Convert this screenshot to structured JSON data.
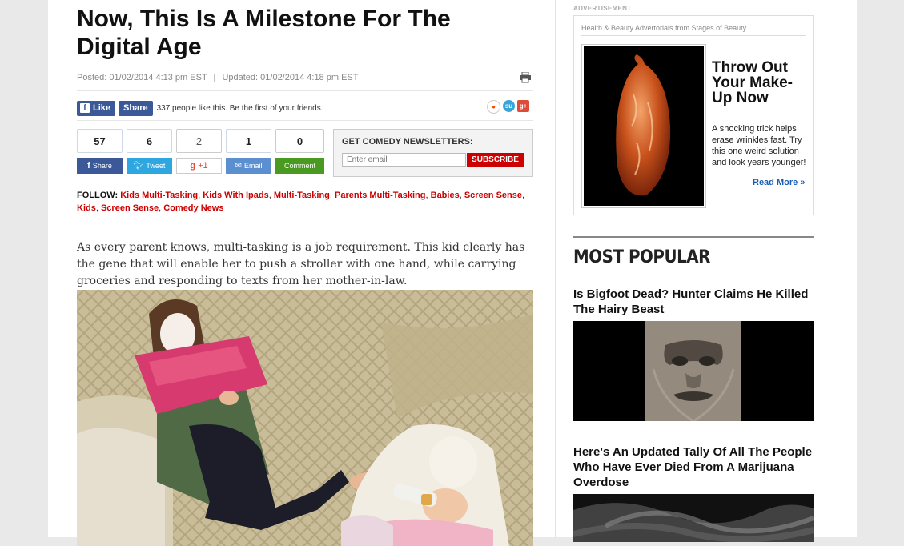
{
  "article": {
    "headline": "Now, This Is A Milestone For The Digital Age",
    "posted": "Posted: 01/02/2014 4:13 pm EST",
    "separator": "|",
    "updated": "Updated: 01/02/2014 4:18 pm EST",
    "lead": "As every parent knows, multi-tasking is a job requirement. This kid clearly has the gene that will enable her to push a stroller with one hand, while carrying groceries and responding to texts from her mother-in-law."
  },
  "social_bar": {
    "like_label": "Like",
    "share_label": "Share",
    "like_text": "337 people like this. Be the first of your friends."
  },
  "counters": [
    {
      "count": "57",
      "label": "Share",
      "color": "#3b5998",
      "icon": "f"
    },
    {
      "count": "6",
      "label": "Tweet",
      "color": "#2ea7e0",
      "icon": "t"
    },
    {
      "count": "2",
      "label": "+1",
      "color": "#ffffff",
      "icon": "g"
    },
    {
      "count": "1",
      "label": "Email",
      "color": "#5b8fd0",
      "icon": "e"
    },
    {
      "count": "0",
      "label": "Comment",
      "color": "#4a9a22",
      "icon": ""
    }
  ],
  "newsletter": {
    "title": "GET COMEDY NEWSLETTERS:",
    "placeholder": "Enter email",
    "button": "SUBSCRIBE"
  },
  "follow": {
    "label": "FOLLOW:",
    "tags": [
      "Kids Multi-Tasking",
      "Kids With Ipads",
      "Multi-Tasking",
      "Parents Multi-Tasking",
      "Babies",
      "Screen Sense",
      "Kids",
      "Screen Sense",
      "Comedy News"
    ]
  },
  "ad": {
    "label": "ADVERTISEMENT",
    "sponsor": "Health & Beauty Advertorials from Stages of Beauty",
    "headline": "Throw Out Your Make-Up Now",
    "body": "A shocking trick helps erase wrinkles fast. Try this one weird solution and look years younger!",
    "cta": "Read More »"
  },
  "most_popular": {
    "title": "MOST POPULAR",
    "stories": [
      {
        "title": "Is Bigfoot Dead? Hunter Claims He Killed The Hairy Beast"
      },
      {
        "title": "Here's An Updated Tally Of All The People Who Have Ever Died From A Marijuana Overdose"
      }
    ]
  },
  "colors": {
    "accent_red": "#cc0000",
    "facebook": "#3b5998",
    "link_blue": "#1a5db5"
  }
}
